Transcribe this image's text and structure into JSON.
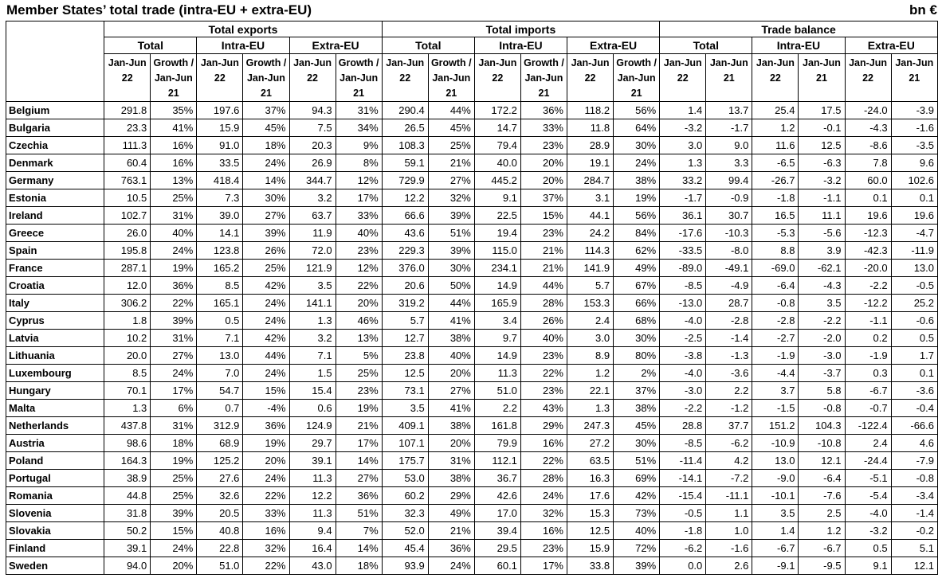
{
  "title": "Member States’ total trade (intra-EU + extra-EU)",
  "unit": "bn €",
  "header": {
    "groups": [
      "Total exports",
      "Total imports",
      "Trade balance"
    ],
    "subgroups": [
      "Total",
      "Intra-EU",
      "Extra-EU",
      "Total",
      "Intra-EU",
      "Extra-EU",
      "Total",
      "Intra-EU",
      "Extra-EU"
    ],
    "columns": [
      "Jan-Jun 22",
      "Growth / Jan-Jun 21",
      "Jan-Jun 22",
      "Growth / Jan-Jun 21",
      "Jan-Jun 22",
      "Growth / Jan-Jun 21",
      "Jan-Jun 22",
      "Growth / Jan-Jun 21",
      "Jan-Jun 22",
      "Growth / Jan-Jun 21",
      "Jan-Jun 22",
      "Growth / Jan-Jun 21",
      "Jan-Jun 22",
      "Jan-Jun 21",
      "Jan-Jun 22",
      "Jan-Jun 21",
      "Jan-Jun 22",
      "Jan-Jun 21"
    ]
  },
  "rows": [
    {
      "country": "Belgium",
      "values": [
        "291.8",
        "35%",
        "197.6",
        "37%",
        "94.3",
        "31%",
        "290.4",
        "44%",
        "172.2",
        "36%",
        "118.2",
        "56%",
        "1.4",
        "13.7",
        "25.4",
        "17.5",
        "-24.0",
        "-3.9"
      ]
    },
    {
      "country": "Bulgaria",
      "values": [
        "23.3",
        "41%",
        "15.9",
        "45%",
        "7.5",
        "34%",
        "26.5",
        "45%",
        "14.7",
        "33%",
        "11.8",
        "64%",
        "-3.2",
        "-1.7",
        "1.2",
        "-0.1",
        "-4.3",
        "-1.6"
      ]
    },
    {
      "country": "Czechia",
      "values": [
        "111.3",
        "16%",
        "91.0",
        "18%",
        "20.3",
        "9%",
        "108.3",
        "25%",
        "79.4",
        "23%",
        "28.9",
        "30%",
        "3.0",
        "9.0",
        "11.6",
        "12.5",
        "-8.6",
        "-3.5"
      ]
    },
    {
      "country": "Denmark",
      "values": [
        "60.4",
        "16%",
        "33.5",
        "24%",
        "26.9",
        "8%",
        "59.1",
        "21%",
        "40.0",
        "20%",
        "19.1",
        "24%",
        "1.3",
        "3.3",
        "-6.5",
        "-6.3",
        "7.8",
        "9.6"
      ]
    },
    {
      "country": "Germany",
      "values": [
        "763.1",
        "13%",
        "418.4",
        "14%",
        "344.7",
        "12%",
        "729.9",
        "27%",
        "445.2",
        "20%",
        "284.7",
        "38%",
        "33.2",
        "99.4",
        "-26.7",
        "-3.2",
        "60.0",
        "102.6"
      ]
    },
    {
      "country": "Estonia",
      "values": [
        "10.5",
        "25%",
        "7.3",
        "30%",
        "3.2",
        "17%",
        "12.2",
        "32%",
        "9.1",
        "37%",
        "3.1",
        "19%",
        "-1.7",
        "-0.9",
        "-1.8",
        "-1.1",
        "0.1",
        "0.1"
      ]
    },
    {
      "country": "Ireland",
      "values": [
        "102.7",
        "31%",
        "39.0",
        "27%",
        "63.7",
        "33%",
        "66.6",
        "39%",
        "22.5",
        "15%",
        "44.1",
        "56%",
        "36.1",
        "30.7",
        "16.5",
        "11.1",
        "19.6",
        "19.6"
      ]
    },
    {
      "country": "Greece",
      "values": [
        "26.0",
        "40%",
        "14.1",
        "39%",
        "11.9",
        "40%",
        "43.6",
        "51%",
        "19.4",
        "23%",
        "24.2",
        "84%",
        "-17.6",
        "-10.3",
        "-5.3",
        "-5.6",
        "-12.3",
        "-4.7"
      ]
    },
    {
      "country": "Spain",
      "values": [
        "195.8",
        "24%",
        "123.8",
        "26%",
        "72.0",
        "23%",
        "229.3",
        "39%",
        "115.0",
        "21%",
        "114.3",
        "62%",
        "-33.5",
        "-8.0",
        "8.8",
        "3.9",
        "-42.3",
        "-11.9"
      ]
    },
    {
      "country": "France",
      "values": [
        "287.1",
        "19%",
        "165.2",
        "25%",
        "121.9",
        "12%",
        "376.0",
        "30%",
        "234.1",
        "21%",
        "141.9",
        "49%",
        "-89.0",
        "-49.1",
        "-69.0",
        "-62.1",
        "-20.0",
        "13.0"
      ]
    },
    {
      "country": "Croatia",
      "values": [
        "12.0",
        "36%",
        "8.5",
        "42%",
        "3.5",
        "22%",
        "20.6",
        "50%",
        "14.9",
        "44%",
        "5.7",
        "67%",
        "-8.5",
        "-4.9",
        "-6.4",
        "-4.3",
        "-2.2",
        "-0.5"
      ]
    },
    {
      "country": "Italy",
      "values": [
        "306.2",
        "22%",
        "165.1",
        "24%",
        "141.1",
        "20%",
        "319.2",
        "44%",
        "165.9",
        "28%",
        "153.3",
        "66%",
        "-13.0",
        "28.7",
        "-0.8",
        "3.5",
        "-12.2",
        "25.2"
      ]
    },
    {
      "country": "Cyprus",
      "values": [
        "1.8",
        "39%",
        "0.5",
        "24%",
        "1.3",
        "46%",
        "5.7",
        "41%",
        "3.4",
        "26%",
        "2.4",
        "68%",
        "-4.0",
        "-2.8",
        "-2.8",
        "-2.2",
        "-1.1",
        "-0.6"
      ]
    },
    {
      "country": "Latvia",
      "values": [
        "10.2",
        "31%",
        "7.1",
        "42%",
        "3.2",
        "13%",
        "12.7",
        "38%",
        "9.7",
        "40%",
        "3.0",
        "30%",
        "-2.5",
        "-1.4",
        "-2.7",
        "-2.0",
        "0.2",
        "0.5"
      ]
    },
    {
      "country": "Lithuania",
      "values": [
        "20.0",
        "27%",
        "13.0",
        "44%",
        "7.1",
        "5%",
        "23.8",
        "40%",
        "14.9",
        "23%",
        "8.9",
        "80%",
        "-3.8",
        "-1.3",
        "-1.9",
        "-3.0",
        "-1.9",
        "1.7"
      ]
    },
    {
      "country": "Luxembourg",
      "values": [
        "8.5",
        "24%",
        "7.0",
        "24%",
        "1.5",
        "25%",
        "12.5",
        "20%",
        "11.3",
        "22%",
        "1.2",
        "2%",
        "-4.0",
        "-3.6",
        "-4.4",
        "-3.7",
        "0.3",
        "0.1"
      ]
    },
    {
      "country": "Hungary",
      "values": [
        "70.1",
        "17%",
        "54.7",
        "15%",
        "15.4",
        "23%",
        "73.1",
        "27%",
        "51.0",
        "23%",
        "22.1",
        "37%",
        "-3.0",
        "2.2",
        "3.7",
        "5.8",
        "-6.7",
        "-3.6"
      ]
    },
    {
      "country": "Malta",
      "values": [
        "1.3",
        "6%",
        "0.7",
        "-4%",
        "0.6",
        "19%",
        "3.5",
        "41%",
        "2.2",
        "43%",
        "1.3",
        "38%",
        "-2.2",
        "-1.2",
        "-1.5",
        "-0.8",
        "-0.7",
        "-0.4"
      ]
    },
    {
      "country": "Netherlands",
      "values": [
        "437.8",
        "31%",
        "312.9",
        "36%",
        "124.9",
        "21%",
        "409.1",
        "38%",
        "161.8",
        "29%",
        "247.3",
        "45%",
        "28.8",
        "37.7",
        "151.2",
        "104.3",
        "-122.4",
        "-66.6"
      ]
    },
    {
      "country": "Austria",
      "values": [
        "98.6",
        "18%",
        "68.9",
        "19%",
        "29.7",
        "17%",
        "107.1",
        "20%",
        "79.9",
        "16%",
        "27.2",
        "30%",
        "-8.5",
        "-6.2",
        "-10.9",
        "-10.8",
        "2.4",
        "4.6"
      ]
    },
    {
      "country": "Poland",
      "values": [
        "164.3",
        "19%",
        "125.2",
        "20%",
        "39.1",
        "14%",
        "175.7",
        "31%",
        "112.1",
        "22%",
        "63.5",
        "51%",
        "-11.4",
        "4.2",
        "13.0",
        "12.1",
        "-24.4",
        "-7.9"
      ]
    },
    {
      "country": "Portugal",
      "values": [
        "38.9",
        "25%",
        "27.6",
        "24%",
        "11.3",
        "27%",
        "53.0",
        "38%",
        "36.7",
        "28%",
        "16.3",
        "69%",
        "-14.1",
        "-7.2",
        "-9.0",
        "-6.4",
        "-5.1",
        "-0.8"
      ]
    },
    {
      "country": "Romania",
      "values": [
        "44.8",
        "25%",
        "32.6",
        "22%",
        "12.2",
        "36%",
        "60.2",
        "29%",
        "42.6",
        "24%",
        "17.6",
        "42%",
        "-15.4",
        "-11.1",
        "-10.1",
        "-7.6",
        "-5.4",
        "-3.4"
      ]
    },
    {
      "country": "Slovenia",
      "values": [
        "31.8",
        "39%",
        "20.5",
        "33%",
        "11.3",
        "51%",
        "32.3",
        "49%",
        "17.0",
        "32%",
        "15.3",
        "73%",
        "-0.5",
        "1.1",
        "3.5",
        "2.5",
        "-4.0",
        "-1.4"
      ]
    },
    {
      "country": "Slovakia",
      "values": [
        "50.2",
        "15%",
        "40.8",
        "16%",
        "9.4",
        "7%",
        "52.0",
        "21%",
        "39.4",
        "16%",
        "12.5",
        "40%",
        "-1.8",
        "1.0",
        "1.4",
        "1.2",
        "-3.2",
        "-0.2"
      ]
    },
    {
      "country": "Finland",
      "values": [
        "39.1",
        "24%",
        "22.8",
        "32%",
        "16.4",
        "14%",
        "45.4",
        "36%",
        "29.5",
        "23%",
        "15.9",
        "72%",
        "-6.2",
        "-1.6",
        "-6.7",
        "-6.7",
        "0.5",
        "5.1"
      ]
    },
    {
      "country": "Sweden",
      "values": [
        "94.0",
        "20%",
        "51.0",
        "22%",
        "43.0",
        "18%",
        "93.9",
        "24%",
        "60.1",
        "17%",
        "33.8",
        "39%",
        "0.0",
        "2.6",
        "-9.1",
        "-9.5",
        "9.1",
        "12.1"
      ]
    }
  ]
}
